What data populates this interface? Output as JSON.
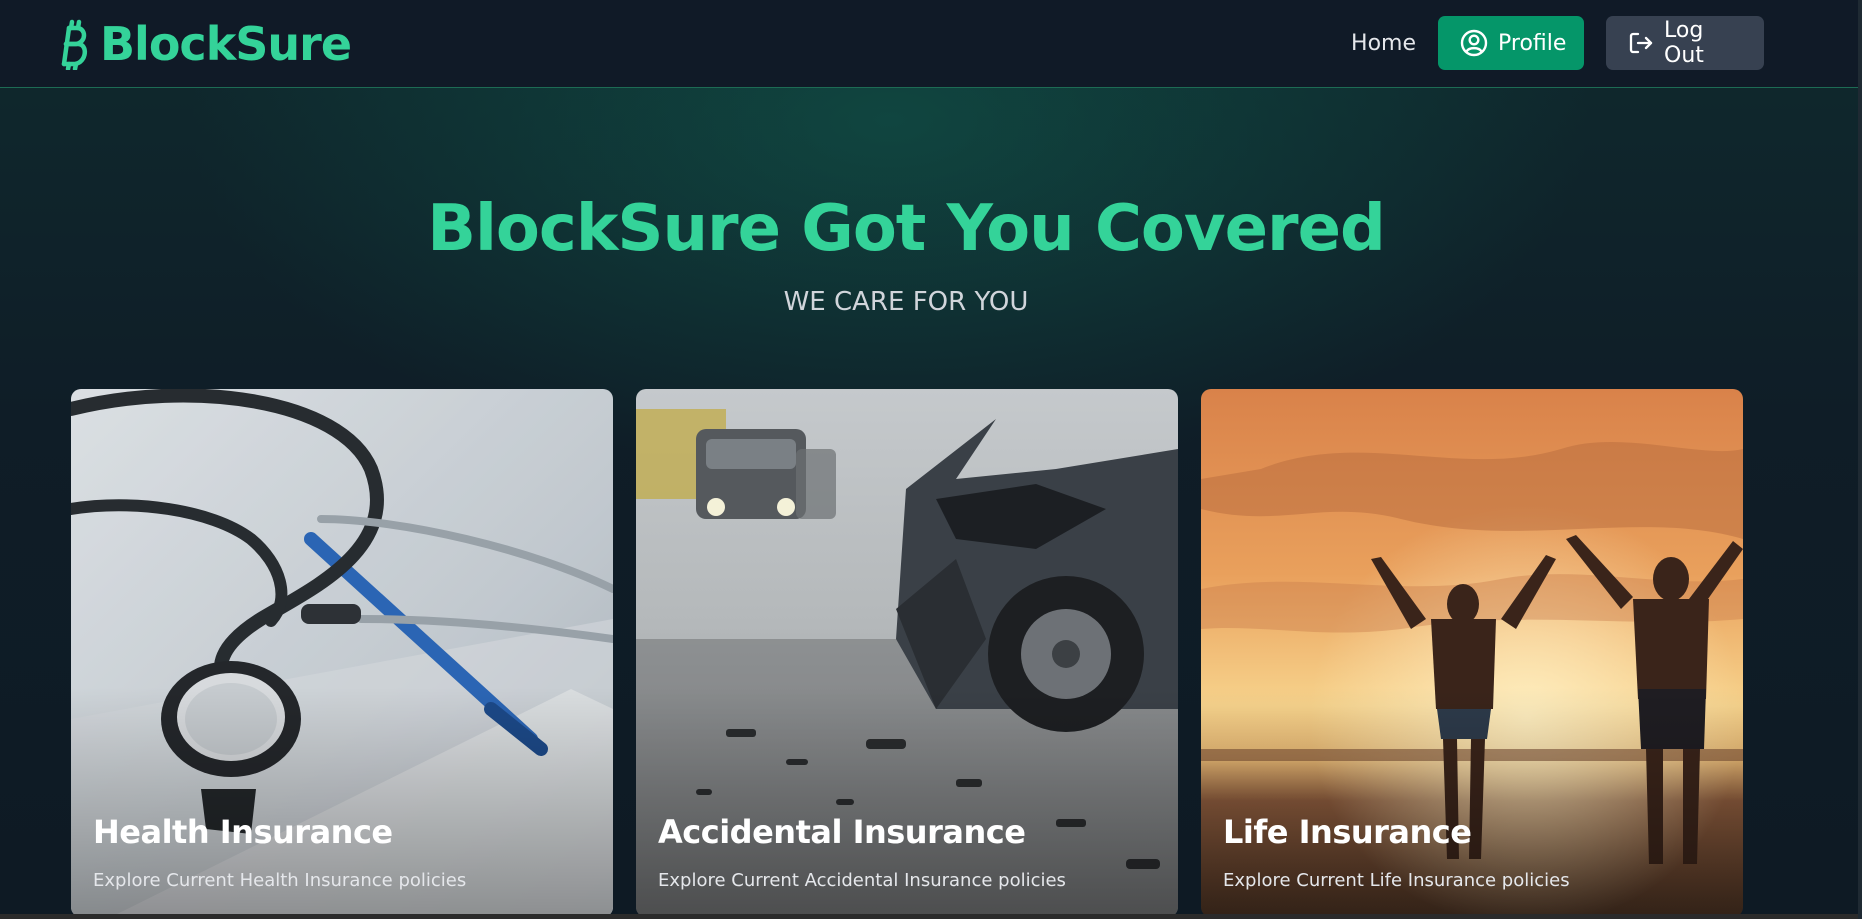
{
  "header": {
    "brand_name": "BlockSure",
    "brand_icon": "bitcoin-icon",
    "nav": {
      "home_label": "Home",
      "profile_label": "Profile",
      "profile_icon": "user-circle-icon",
      "logout_label": "Log Out",
      "logout_icon": "logout-icon"
    }
  },
  "hero": {
    "title": "BlockSure Got You Covered",
    "subtitle": "WE CARE FOR YOU"
  },
  "cards": [
    {
      "title": "Health Insurance",
      "description": "Explore Current Health Insurance policies",
      "image": "stethoscope-and-pen"
    },
    {
      "title": "Accidental Insurance",
      "description": "Explore Current Accidental Insurance policies",
      "image": "crashed-car"
    },
    {
      "title": "Life Insurance",
      "description": "Explore Current Life Insurance policies",
      "image": "people-at-sunset-beach"
    }
  ],
  "colors": {
    "brand_green": "#34d399",
    "profile_button": "#059669",
    "logout_button": "#374151",
    "header_bg": "#101a27"
  }
}
